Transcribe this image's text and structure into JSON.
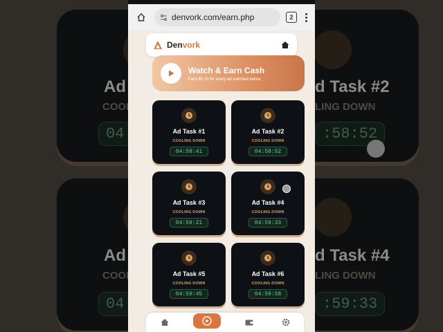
{
  "browser": {
    "url": "denvork.com/earn.php",
    "tab_count": "2"
  },
  "header": {
    "brand_part1": "Den",
    "brand_part2": "vork"
  },
  "hero": {
    "title": "Watch & Earn Cash",
    "subtitle": "Earn $0.15 for every ad watched below."
  },
  "tasks": [
    {
      "title": "Ad Task #1",
      "status": "COOLING DOWN",
      "timer": "04:58:41"
    },
    {
      "title": "Ad Task #2",
      "status": "COOLING DOWN",
      "timer": "04:58:52"
    },
    {
      "title": "Ad Task #3",
      "status": "COOLING DOWN",
      "timer": "04:59:21"
    },
    {
      "title": "Ad Task #4",
      "status": "COOLING DOWN",
      "timer": "04:59:33"
    },
    {
      "title": "Ad Task #5",
      "status": "COOLING DOWN",
      "timer": "04:59:45"
    },
    {
      "title": "Ad Task #6",
      "status": "COOLING DOWN",
      "timer": "04:59:58"
    }
  ],
  "background_zoom": {
    "left_title": "Ad Ta",
    "left_status": "COOLI",
    "left_timer": "04",
    "right_title": "d Task #2",
    "right_status": "LING DOWN",
    "right_timer": ":58:52",
    "left_title_2": "Ad T",
    "left_status_2": "COOL",
    "left_timer_2": "04",
    "right_title_2": "d Task #4",
    "right_status_2": "LING DOWN",
    "right_timer_2": ":59:33"
  },
  "nav": {
    "items": [
      "home-icon",
      "play-icon",
      "wallet-icon",
      "gear-icon"
    ],
    "active": "play-icon"
  },
  "colors": {
    "accent": "#d9773e",
    "card_bg": "#0d1014",
    "timer_text": "#5fd49a",
    "status_text": "#e0a25f",
    "page_bg": "#f2ece4"
  }
}
